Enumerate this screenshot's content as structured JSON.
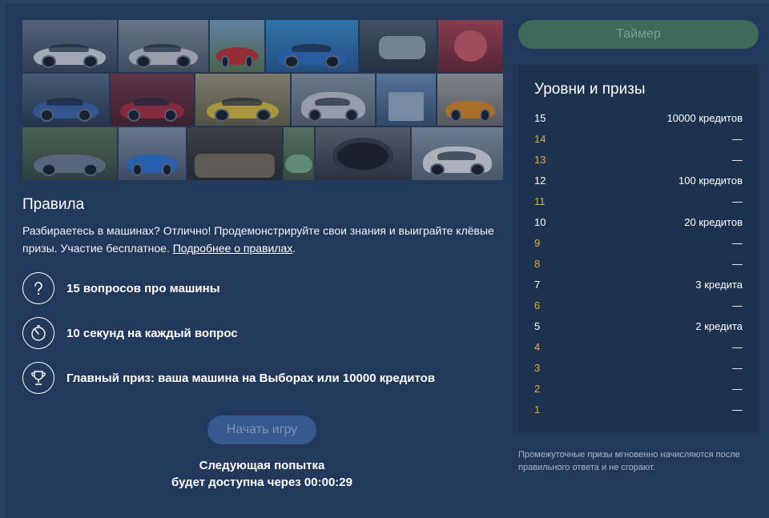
{
  "rules": {
    "title": "Правила",
    "text_before_link": "Разбираетесь в машинах? Отлично! Продемонстрируйте свои знания и выиграйте клёвые призы. Участие бесплатное. ",
    "link_text": "Подробнее о правилах",
    "text_after_link": ".",
    "features": [
      {
        "icon": "question-icon",
        "text": "15 вопросов про машины"
      },
      {
        "icon": "stopwatch-icon",
        "text": "10 секунд на каждый вопрос"
      },
      {
        "icon": "trophy-icon",
        "text": "Главный приз: ваша машина на Выборах или 10000 кредитов"
      }
    ]
  },
  "start_button": "Начать игру",
  "next_try": {
    "line1": "Следующая попытка",
    "line2": "будет доступна через 00:00:29"
  },
  "timer_button": "Таймер",
  "levels": {
    "title": "Уровни и призы",
    "rows": [
      {
        "level": "15",
        "prize": "10000 кредитов",
        "milestone": true
      },
      {
        "level": "14",
        "prize": "—",
        "milestone": false
      },
      {
        "level": "13",
        "prize": "—",
        "milestone": false
      },
      {
        "level": "12",
        "prize": "100 кредитов",
        "milestone": true
      },
      {
        "level": "11",
        "prize": "—",
        "milestone": false
      },
      {
        "level": "10",
        "prize": "20 кредитов",
        "milestone": true
      },
      {
        "level": "9",
        "prize": "—",
        "milestone": false
      },
      {
        "level": "8",
        "prize": "—",
        "milestone": false
      },
      {
        "level": "7",
        "prize": "3 кредита",
        "milestone": true
      },
      {
        "level": "6",
        "prize": "—",
        "milestone": false
      },
      {
        "level": "5",
        "prize": "2 кредита",
        "milestone": true
      },
      {
        "level": "4",
        "prize": "—",
        "milestone": false
      },
      {
        "level": "3",
        "prize": "—",
        "milestone": false
      },
      {
        "level": "2",
        "prize": "—",
        "milestone": false
      },
      {
        "level": "1",
        "prize": "—",
        "milestone": false
      }
    ]
  },
  "note": "Промежуточные призы мгновенно начисляются после правильного ответа и не сгорают.",
  "colors": {
    "background": "#23395b",
    "panel": "#1c324f",
    "gold_level": "#d9b048",
    "timer_button": "#3e6a5c",
    "start_button": "#36598e"
  }
}
